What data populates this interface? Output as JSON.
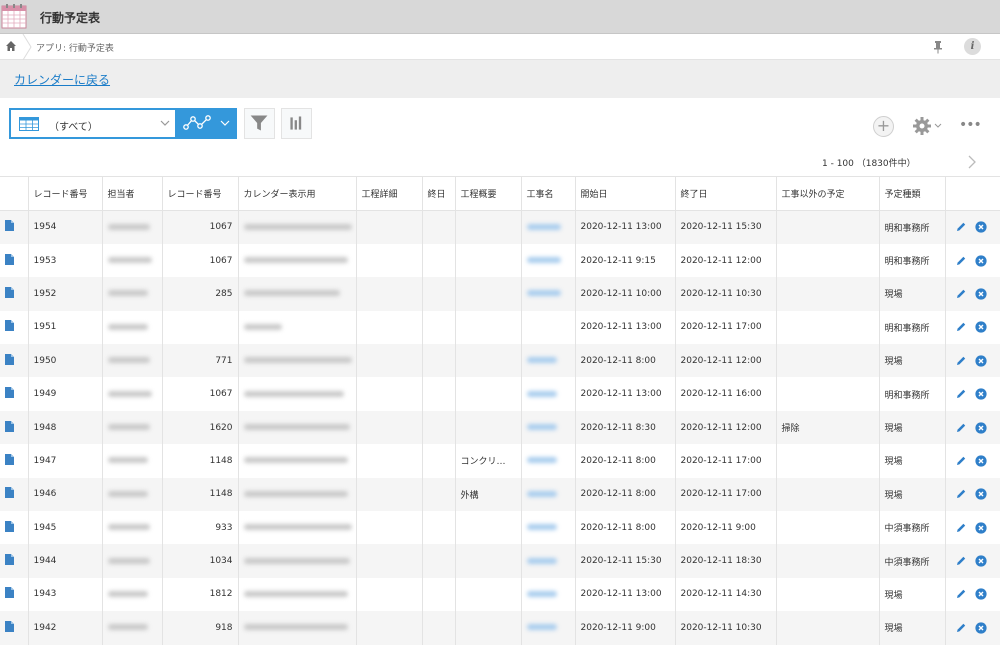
{
  "app": {
    "title": "行動予定表",
    "breadcrumb": "アプリ: 行動予定表"
  },
  "nav": {
    "back_link": "カレンダーに戻る"
  },
  "toolbar": {
    "view_label": "（すべて）"
  },
  "pager": {
    "text": "1 - 100 （1830件中）"
  },
  "colors": {
    "accent": "#3498db",
    "link": "#1a7cc8",
    "row_alt": "#f5f5f5"
  },
  "table": {
    "headers": [
      "レコード番号",
      "担当者",
      "レコード番号",
      "カレンダー表示用",
      "工程詳細",
      "終日",
      "工程概要",
      "工事名",
      "開始日",
      "終了日",
      "工事以外の予定",
      "予定種類"
    ],
    "rows": [
      {
        "id": "1954",
        "num": "1067",
        "summary": "",
        "start": "2020-12-11 13:00",
        "end": "2020-12-11 15:30",
        "other": "",
        "type": "明和事務所",
        "cal_w": 108,
        "user_w": 42,
        "proj_w": 34
      },
      {
        "id": "1953",
        "num": "1067",
        "summary": "",
        "start": "2020-12-11 9:15",
        "end": "2020-12-11 12:00",
        "other": "",
        "type": "明和事務所",
        "cal_w": 104,
        "user_w": 44,
        "proj_w": 34
      },
      {
        "id": "1952",
        "num": "285",
        "summary": "",
        "start": "2020-12-11 10:00",
        "end": "2020-12-11 10:30",
        "other": "",
        "type": "現場",
        "cal_w": 96,
        "user_w": 40,
        "proj_w": 34
      },
      {
        "id": "1951",
        "num": "",
        "summary": "",
        "start": "2020-12-11 13:00",
        "end": "2020-12-11 17:00",
        "other": "",
        "type": "明和事務所",
        "cal_w": 38,
        "user_w": 40,
        "proj_w": 0
      },
      {
        "id": "1950",
        "num": "771",
        "summary": "",
        "start": "2020-12-11 8:00",
        "end": "2020-12-11 12:00",
        "other": "",
        "type": "現場",
        "cal_w": 108,
        "user_w": 42,
        "proj_w": 30
      },
      {
        "id": "1949",
        "num": "1067",
        "summary": "",
        "start": "2020-12-11 13:00",
        "end": "2020-12-11 16:00",
        "other": "",
        "type": "明和事務所",
        "cal_w": 100,
        "user_w": 44,
        "proj_w": 30
      },
      {
        "id": "1948",
        "num": "1620",
        "summary": "",
        "start": "2020-12-11 8:30",
        "end": "2020-12-11 12:00",
        "other": "掃除",
        "type": "現場",
        "cal_w": 106,
        "user_w": 42,
        "proj_w": 30
      },
      {
        "id": "1947",
        "num": "1148",
        "summary": "コンクリ…",
        "start": "2020-12-11 8:00",
        "end": "2020-12-11 17:00",
        "other": "",
        "type": "現場",
        "cal_w": 104,
        "user_w": 40,
        "proj_w": 30
      },
      {
        "id": "1946",
        "num": "1148",
        "summary": "外構",
        "start": "2020-12-11 8:00",
        "end": "2020-12-11 17:00",
        "other": "",
        "type": "現場",
        "cal_w": 104,
        "user_w": 40,
        "proj_w": 30
      },
      {
        "id": "1945",
        "num": "933",
        "summary": "",
        "start": "2020-12-11 8:00",
        "end": "2020-12-11 9:00",
        "other": "",
        "type": "中須事務所",
        "cal_w": 108,
        "user_w": 42,
        "proj_w": 30
      },
      {
        "id": "1944",
        "num": "1034",
        "summary": "",
        "start": "2020-12-11 15:30",
        "end": "2020-12-11 18:30",
        "other": "",
        "type": "中須事務所",
        "cal_w": 106,
        "user_w": 42,
        "proj_w": 30
      },
      {
        "id": "1943",
        "num": "1812",
        "summary": "",
        "start": "2020-12-11 13:00",
        "end": "2020-12-11 14:30",
        "other": "",
        "type": "現場",
        "cal_w": 104,
        "user_w": 40,
        "proj_w": 30
      },
      {
        "id": "1942",
        "num": "918",
        "summary": "",
        "start": "2020-12-11 9:00",
        "end": "2020-12-11 10:30",
        "other": "",
        "type": "現場",
        "cal_w": 104,
        "user_w": 40,
        "proj_w": 30
      }
    ]
  }
}
